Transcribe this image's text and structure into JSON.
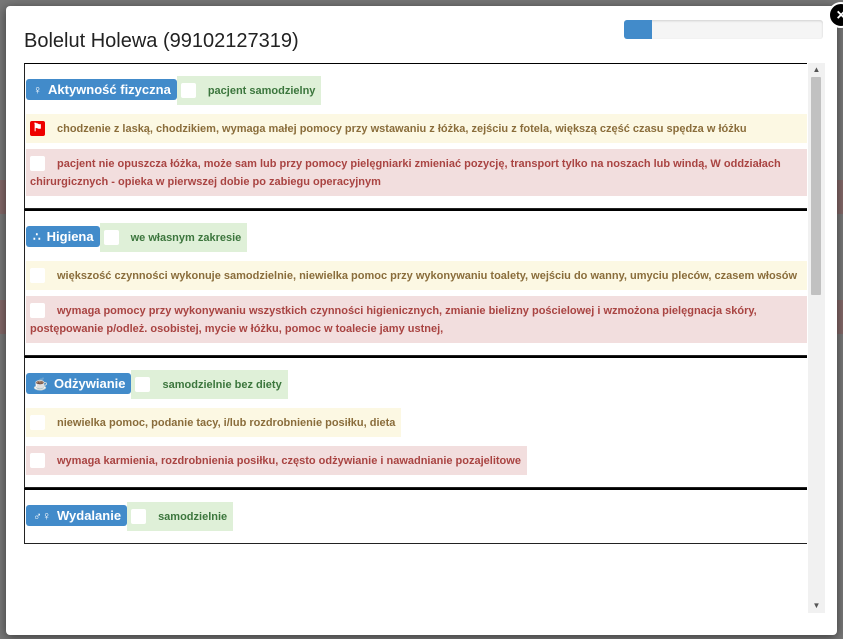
{
  "modal": {
    "title": "Bolelut Holewa (99102127319)",
    "close_label": "×",
    "progress": 0.14
  },
  "sections": [
    {
      "name": "Aktywność fizyczna",
      "icon": "person-icon",
      "options": [
        {
          "text": "pacjent samodzielny",
          "level": "green",
          "checked": false
        },
        {
          "text": "chodzenie z laską, chodzikiem, wymaga małej pomocy przy wstawaniu z łóżka, zejściu z fotela, większą część czasu spędza w łóżku",
          "level": "yellow",
          "checked": true
        },
        {
          "text": "pacjent nie opuszcza łóżka, może sam lub przy pomocy pielęgniarki zmieniać pozycję, transport tylko na noszach lub windą, W oddziałach chirurgicznych - opieka w pierwszej dobie po zabiegu operacyjnym",
          "level": "red",
          "checked": false
        }
      ]
    },
    {
      "name": "Higiena",
      "icon": "water-drops-icon",
      "options": [
        {
          "text": "we własnym zakresie",
          "level": "green",
          "checked": false
        },
        {
          "text": "większość czynności wykonuje samodzielnie, niewielka pomoc przy wykonywaniu toalety, wejściu do wanny, umyciu pleców, czasem włosów",
          "level": "yellow",
          "checked": false
        },
        {
          "text": "wymaga pomocy przy wykonywaniu wszystkich czynności higienicznych, zmianie bielizny pościelowej i wzmożona pielęgnacja skóry, postępowanie p/odleż. osobistej, mycie w łóżku, pomoc w toalecie jamy ustnej,",
          "level": "red",
          "checked": false
        }
      ]
    },
    {
      "name": "Odżywianie",
      "icon": "cup-icon",
      "options": [
        {
          "text": "samodzielnie bez diety",
          "level": "green",
          "checked": false
        },
        {
          "text": "niewielka pomoc, podanie tacy, i/lub rozdrobnienie posiłku, dieta",
          "level": "yellow",
          "checked": false
        },
        {
          "text": "wymaga karmienia, rozdrobnienia posiłku, często odżywianie i nawadnianie pozajelitowe",
          "level": "red",
          "checked": false
        }
      ]
    },
    {
      "name": "Wydalanie",
      "icon": "restroom-icon",
      "options": [
        {
          "text": "samodzielnie",
          "level": "green",
          "checked": false
        }
      ]
    }
  ]
}
